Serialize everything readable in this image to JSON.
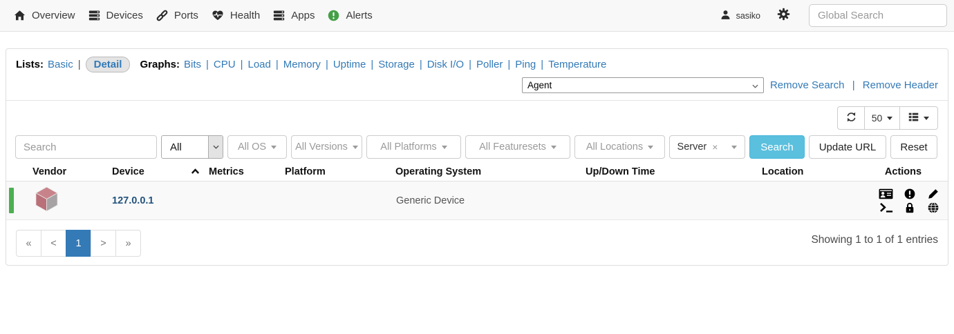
{
  "ui": {
    "pipe": "|"
  },
  "navbar": {
    "items": [
      {
        "label": "Overview",
        "icon": "home-icon"
      },
      {
        "label": "Devices",
        "icon": "server-stack-icon"
      },
      {
        "label": "Ports",
        "icon": "link-icon"
      },
      {
        "label": "Health",
        "icon": "heartbeat-icon"
      },
      {
        "label": "Apps",
        "icon": "apps-stack-icon"
      },
      {
        "label": "Alerts",
        "icon": "alert-circle-icon"
      }
    ],
    "user_name": "sasiko",
    "user_icon": "user-icon",
    "settings_icon": "gear-icon",
    "global_search_placeholder": "Global Search"
  },
  "list_header": {
    "lists_label": "Lists:",
    "basic_link": "Basic",
    "detail_button": "Detail",
    "graphs_label": "Graphs:",
    "graph_links": [
      "Bits",
      "CPU",
      "Load",
      "Memory",
      "Uptime",
      "Storage",
      "Disk I/O",
      "Poller",
      "Ping",
      "Temperature"
    ],
    "format_select_value": "Agent",
    "remove_search_link": "Remove Search",
    "remove_header_link": "Remove Header"
  },
  "toolbar": {
    "refresh_icon": "refresh-icon",
    "page_size_value": "50",
    "layout_icon": "list-layout-icon"
  },
  "filter_bar": {
    "search_placeholder": "Search",
    "state_select_value": "All",
    "dropdowns": [
      "All OS",
      "All Versions",
      "All Platforms",
      "All Featuresets",
      "All Locations"
    ],
    "group_tag": "Server",
    "group_tag_remove": "×",
    "search_button": "Search",
    "update_url_button": "Update URL",
    "reset_button": "Reset"
  },
  "device_table": {
    "headers": [
      "Vendor",
      "Device",
      "Metrics",
      "Platform",
      "Operating System",
      "Up/Down Time",
      "Location",
      "Actions"
    ],
    "sort_column": "Device",
    "sort_direction": "asc",
    "rows": [
      {
        "status": "up",
        "vendor_icon": "generic-device-cube-icon",
        "device_link": "127.0.0.1",
        "metrics": "",
        "platform": "",
        "operating_system": "Generic Device",
        "up_down_time": "",
        "location": "",
        "action_icons": [
          "id-card-icon",
          "alert-icon",
          "edit-icon",
          "terminal-icon",
          "lock-icon",
          "globe-icon"
        ]
      }
    ]
  },
  "pagination": {
    "first": "«",
    "previous": "<",
    "page_1": "1",
    "next": ">",
    "last": "»",
    "active_page": "1",
    "summary": "Showing 1 to 1 of 1 entries"
  },
  "colors": {
    "link_blue": "#337ab7",
    "device_link_blue": "#23527c",
    "search_button_teal": "#5bc0de",
    "status_up_green": "#4caf50",
    "active_page_blue": "#337ab7",
    "alert_icon_green": "#44a047",
    "row_stripe": "#f9f9f9",
    "navbar_bg": "#f8f8f8"
  }
}
